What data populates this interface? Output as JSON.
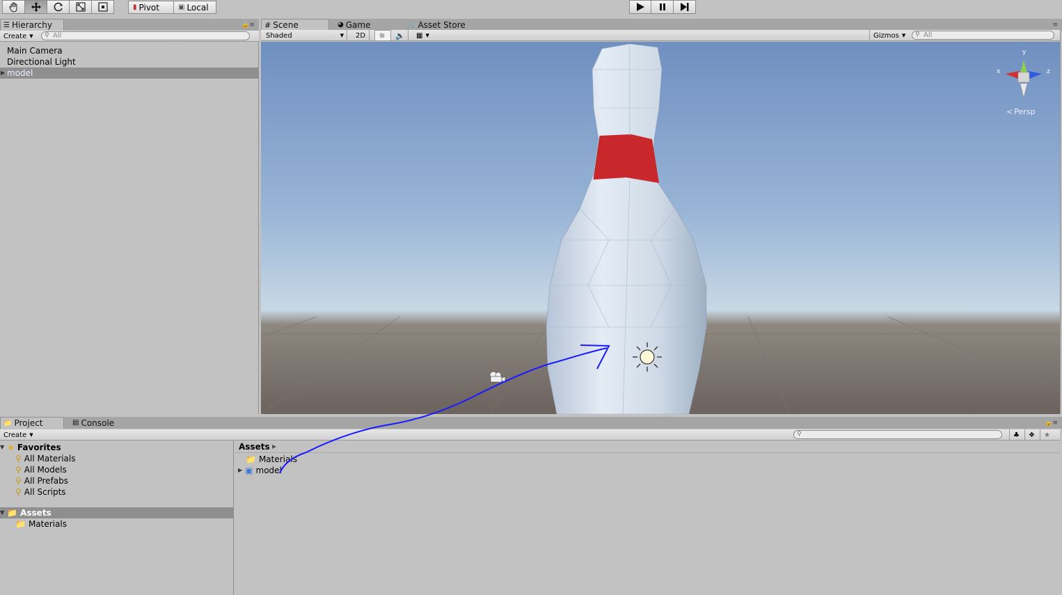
{
  "toolbar": {
    "tools": [
      "hand-tool",
      "move-tool",
      "rotate-tool",
      "scale-tool",
      "rect-tool"
    ],
    "pivot_label": "Pivot",
    "local_label": "Local",
    "play_controls": [
      "play",
      "pause",
      "step"
    ]
  },
  "hierarchy": {
    "tab_label": "Hierarchy",
    "create_label": "Create",
    "search_placeholder": "All",
    "items": [
      "Main Camera",
      "Directional Light",
      "model"
    ],
    "selected": "model"
  },
  "scene": {
    "tabs": [
      "Scene",
      "Game",
      "Asset Store"
    ],
    "active_tab": "Scene",
    "shading_mode": "Shaded",
    "mode_2d_label": "2D",
    "gizmos_label": "Gizmos",
    "search_placeholder": "All",
    "persp_label": "Persp",
    "axis_labels": {
      "x": "x",
      "y": "y",
      "z": "z"
    }
  },
  "project": {
    "tabs": [
      "Project",
      "Console"
    ],
    "active_tab": "Project",
    "create_label": "Create",
    "favorites_label": "Favorites",
    "favorites": [
      "All Materials",
      "All Models",
      "All Prefabs",
      "All Scripts"
    ],
    "assets_label": "Assets",
    "asset_folders": [
      "Materials"
    ],
    "breadcrumb": "Assets",
    "content": [
      "Materials",
      "model"
    ]
  },
  "colors": {
    "selection": "#8f8f8f",
    "annotation_arrow": "#1a1aff",
    "pin_stripe": "#c8282c"
  }
}
